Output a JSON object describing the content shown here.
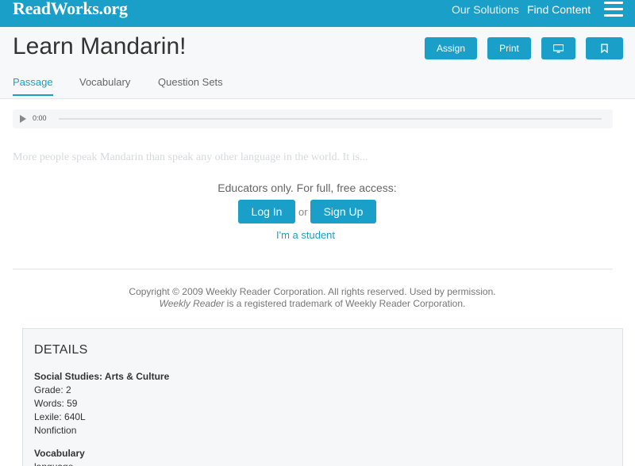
{
  "header": {
    "logo": "ReadWorks.org",
    "nav": {
      "solutions": "Our Solutions",
      "find_content": "Find Content"
    },
    "menu_icon": "hamburger-menu-icon"
  },
  "title_bar": {
    "title": "Learn Mandarin!",
    "buttons": {
      "assign": "Assign",
      "print": "Print",
      "present_icon": "monitor-icon",
      "bookmark_icon": "bookmark-icon"
    },
    "tabs": {
      "passage": "Passage",
      "vocabulary": "Vocabulary",
      "question_sets": "Question Sets"
    }
  },
  "audio": {
    "time": "0:00",
    "play_icon": "play-icon"
  },
  "passage": {
    "excerpt": "More people speak Mandarin than speak any other language in the world. It is..."
  },
  "access": {
    "prompt": "Educators only. For full, free access:",
    "login": "Log In",
    "or": "or",
    "signup": "Sign Up",
    "student": "I'm a student"
  },
  "copyright": {
    "line1": "Copyright © 2009 Weekly Reader Corporation. All rights reserved. Used by permission.",
    "line2_em": "Weekly Reader",
    "line2_rest": " is a registered trademark of Weekly Reader Corporation."
  },
  "details": {
    "heading": "DETAILS",
    "subject": "Social Studies: Arts & Culture",
    "grade": "Grade: 2",
    "words": "Words: 59",
    "lexile": "Lexile: 640L",
    "type": "Nonfiction",
    "vocab_heading": "Vocabulary",
    "vocab_first": "language"
  },
  "colors": {
    "brand": "#1a9fc8",
    "details_bg": "#f6f7f8"
  }
}
